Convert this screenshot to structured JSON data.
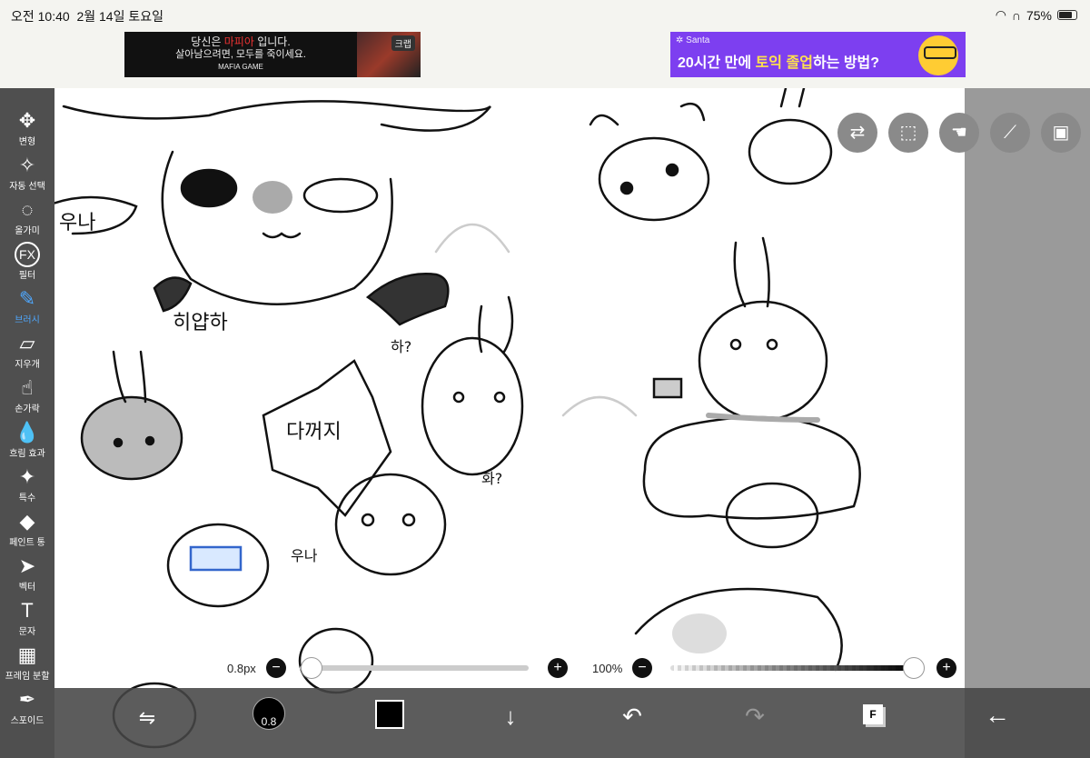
{
  "status": {
    "time": "오전 10:40",
    "date": "2월 14일 토요일",
    "battery_pct": "75%",
    "battery_level": 0.75
  },
  "ads": {
    "left": {
      "line1_pre": "당신은 ",
      "line1_hl": "마피아",
      "line1_post": " 입니다.",
      "line2": "살아남으려면, 모두를 죽이세요.",
      "line3": "MAFIA GAME",
      "badge": "크랩"
    },
    "right": {
      "brand": "Santa",
      "headline_pre": "20시간 만에 ",
      "headline_hl1": "토익",
      "headline_mid": " ",
      "headline_hl2": "졸업",
      "headline_post": "하는 방법?"
    }
  },
  "tools": [
    {
      "label": "변형",
      "icon": "move-icon",
      "glyph": "✥"
    },
    {
      "label": "자동 선택",
      "icon": "magic-wand-icon",
      "glyph": "✧"
    },
    {
      "label": "올가미",
      "icon": "lasso-icon",
      "glyph": "◌"
    },
    {
      "label": "필터",
      "icon": "fx-icon",
      "glyph": "FX"
    },
    {
      "label": "브러시",
      "icon": "brush-icon",
      "glyph": "✎",
      "active": true
    },
    {
      "label": "지우개",
      "icon": "eraser-icon",
      "glyph": "▱"
    },
    {
      "label": "손가락",
      "icon": "smudge-icon",
      "glyph": "☝"
    },
    {
      "label": "흐림 효과",
      "icon": "blur-icon",
      "glyph": "💧"
    },
    {
      "label": "특수",
      "icon": "special-brush-icon",
      "glyph": "✦"
    },
    {
      "label": "페인트 통",
      "icon": "paint-bucket-icon",
      "glyph": "◆"
    },
    {
      "label": "벡터",
      "icon": "vector-icon",
      "glyph": "➤"
    },
    {
      "label": "문자",
      "icon": "text-icon",
      "glyph": "T"
    },
    {
      "label": "프레임 분할",
      "icon": "frame-divider-icon",
      "glyph": "▦"
    },
    {
      "label": "스포이드",
      "icon": "eyedropper-icon",
      "glyph": "✒"
    }
  ],
  "sliders": {
    "brush_size_label": "0.8px",
    "brush_size_level": 0.02,
    "opacity_label": "100%",
    "opacity_level": 1.0
  },
  "bottom": {
    "brush_value": "0.8",
    "layer_label": "F"
  },
  "colors": {
    "toolbar": "#4f4f4f",
    "active": "#4fa8ff",
    "ad_right": "#7d3ff0"
  }
}
